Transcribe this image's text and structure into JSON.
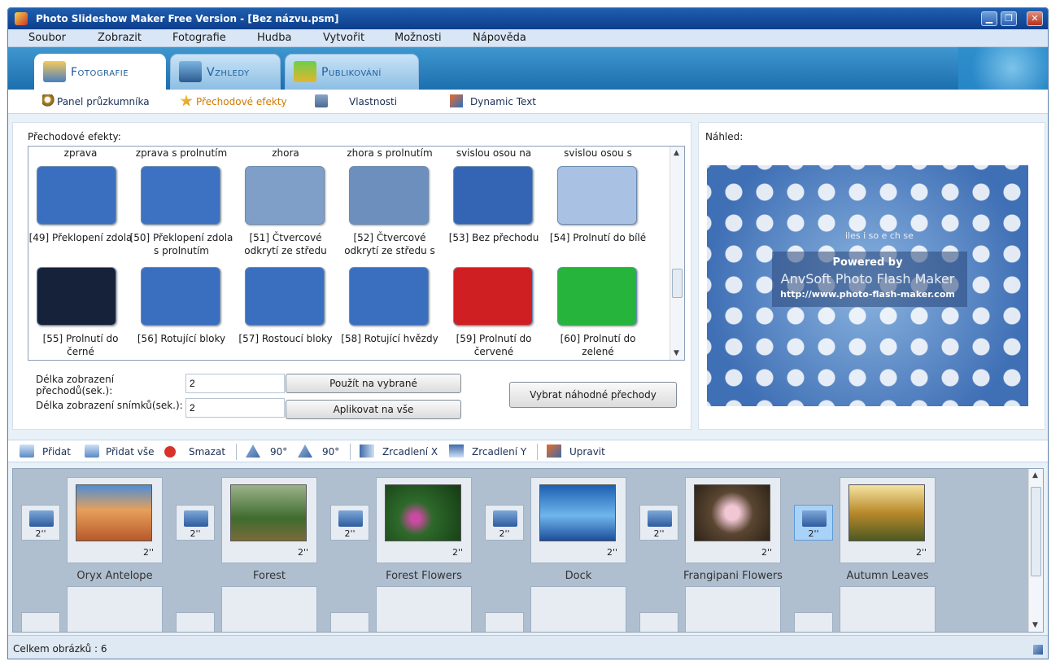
{
  "window": {
    "title": "Photo Slideshow Maker Free Version - [Bez názvu.psm]",
    "minimize": "▁",
    "maximize": "❐",
    "close": "✕"
  },
  "menu": [
    "Soubor",
    "Zobrazit",
    "Fotografie",
    "Hudba",
    "Vytvořit",
    "Možnosti",
    "Nápověda"
  ],
  "tabs": [
    {
      "label": "Fotografie",
      "active": true
    },
    {
      "label": "Vzhledy"
    },
    {
      "label": "Publikování"
    }
  ],
  "subtabs": [
    "Panel průzkumníka",
    "Přechodové efekty",
    "Vlastnosti",
    "Dynamic Text"
  ],
  "effects": {
    "label": "Přechodové efekty:",
    "partial_top": [
      "zprava",
      "zprava s prolnutím",
      "zhora",
      "zhora s prolnutím",
      "svislou osou na",
      "svislou osou s"
    ],
    "row1": [
      {
        "name": "[49] Překlopení zdola",
        "color": "#3a6fc0"
      },
      {
        "name": "[50] Překlopení zdola s prolnutím",
        "color": "#3d72c2"
      },
      {
        "name": "[51] Čtvercové odkrytí ze středu",
        "color": "#7f9fc9"
      },
      {
        "name": "[52] Čtvercové odkrytí ze středu s",
        "color": "#6d8fbd"
      },
      {
        "name": "[53] Bez přechodu",
        "color": "#3465b5"
      },
      {
        "name": "[54] Prolnutí do bílé",
        "color": "#a9c1e3"
      }
    ],
    "row2": [
      {
        "name": "[55] Prolnutí do černé",
        "color": "#15223a"
      },
      {
        "name": "[56] Rotující bloky",
        "color": "#3a6fc0"
      },
      {
        "name": "[57] Rostoucí bloky",
        "color": "#3a6fc0"
      },
      {
        "name": "[58] Rotující hvězdy",
        "color": "#3a6fc0"
      },
      {
        "name": "[59] Prolnutí do červené",
        "color": "#d01f22"
      },
      {
        "name": "[60] Prolnutí do zelené",
        "color": "#26b43c"
      }
    ]
  },
  "settings": {
    "transition_label": "Délka zobrazení přechodů(sek.):",
    "transition_value": "2",
    "slide_label": "Délka zobrazení snímků(sek.):",
    "slide_value": "2",
    "apply_selected": "Použít na vybrané",
    "apply_all": "Aplikovat na vše",
    "random": "Vybrat náhodné přechody"
  },
  "preview": {
    "label": "Náhled:",
    "powered": "Powered by",
    "brand": "AnvSoft Photo Flash Maker",
    "url": "http://www.photo-flash-maker.com",
    "faint": "iles i  so e  ch se"
  },
  "toolbar": {
    "add": "Přidat",
    "add_all": "Přidat vše",
    "delete": "Smazat",
    "rot_left": "90°",
    "rot_right": "90°",
    "mirror_x": "Zrcadlení X",
    "mirror_y": "Zrcadlení Y",
    "edit": "Upravit"
  },
  "slides": [
    {
      "name": "Oryx Antelope",
      "dur": "2''",
      "bg": "#c86e3c"
    },
    {
      "name": "Forest",
      "dur": "2''",
      "bg": "#3f6b2e"
    },
    {
      "name": "Forest Flowers",
      "dur": "2''",
      "bg": "#2e6a2a"
    },
    {
      "name": "Dock",
      "dur": "2''",
      "bg": "#2d7dc9"
    },
    {
      "name": "Frangipani Flowers",
      "dur": "2''",
      "bg": "#5a4632"
    },
    {
      "name": "Autumn Leaves",
      "dur": "2''",
      "bg": "#b8892a"
    }
  ],
  "transitions": [
    {
      "dur": "2''"
    },
    {
      "dur": "2''"
    },
    {
      "dur": "2''"
    },
    {
      "dur": "2''"
    },
    {
      "dur": "2''"
    },
    {
      "dur": "2''",
      "selected": true
    }
  ],
  "status": "Celkem obrázků : 6"
}
